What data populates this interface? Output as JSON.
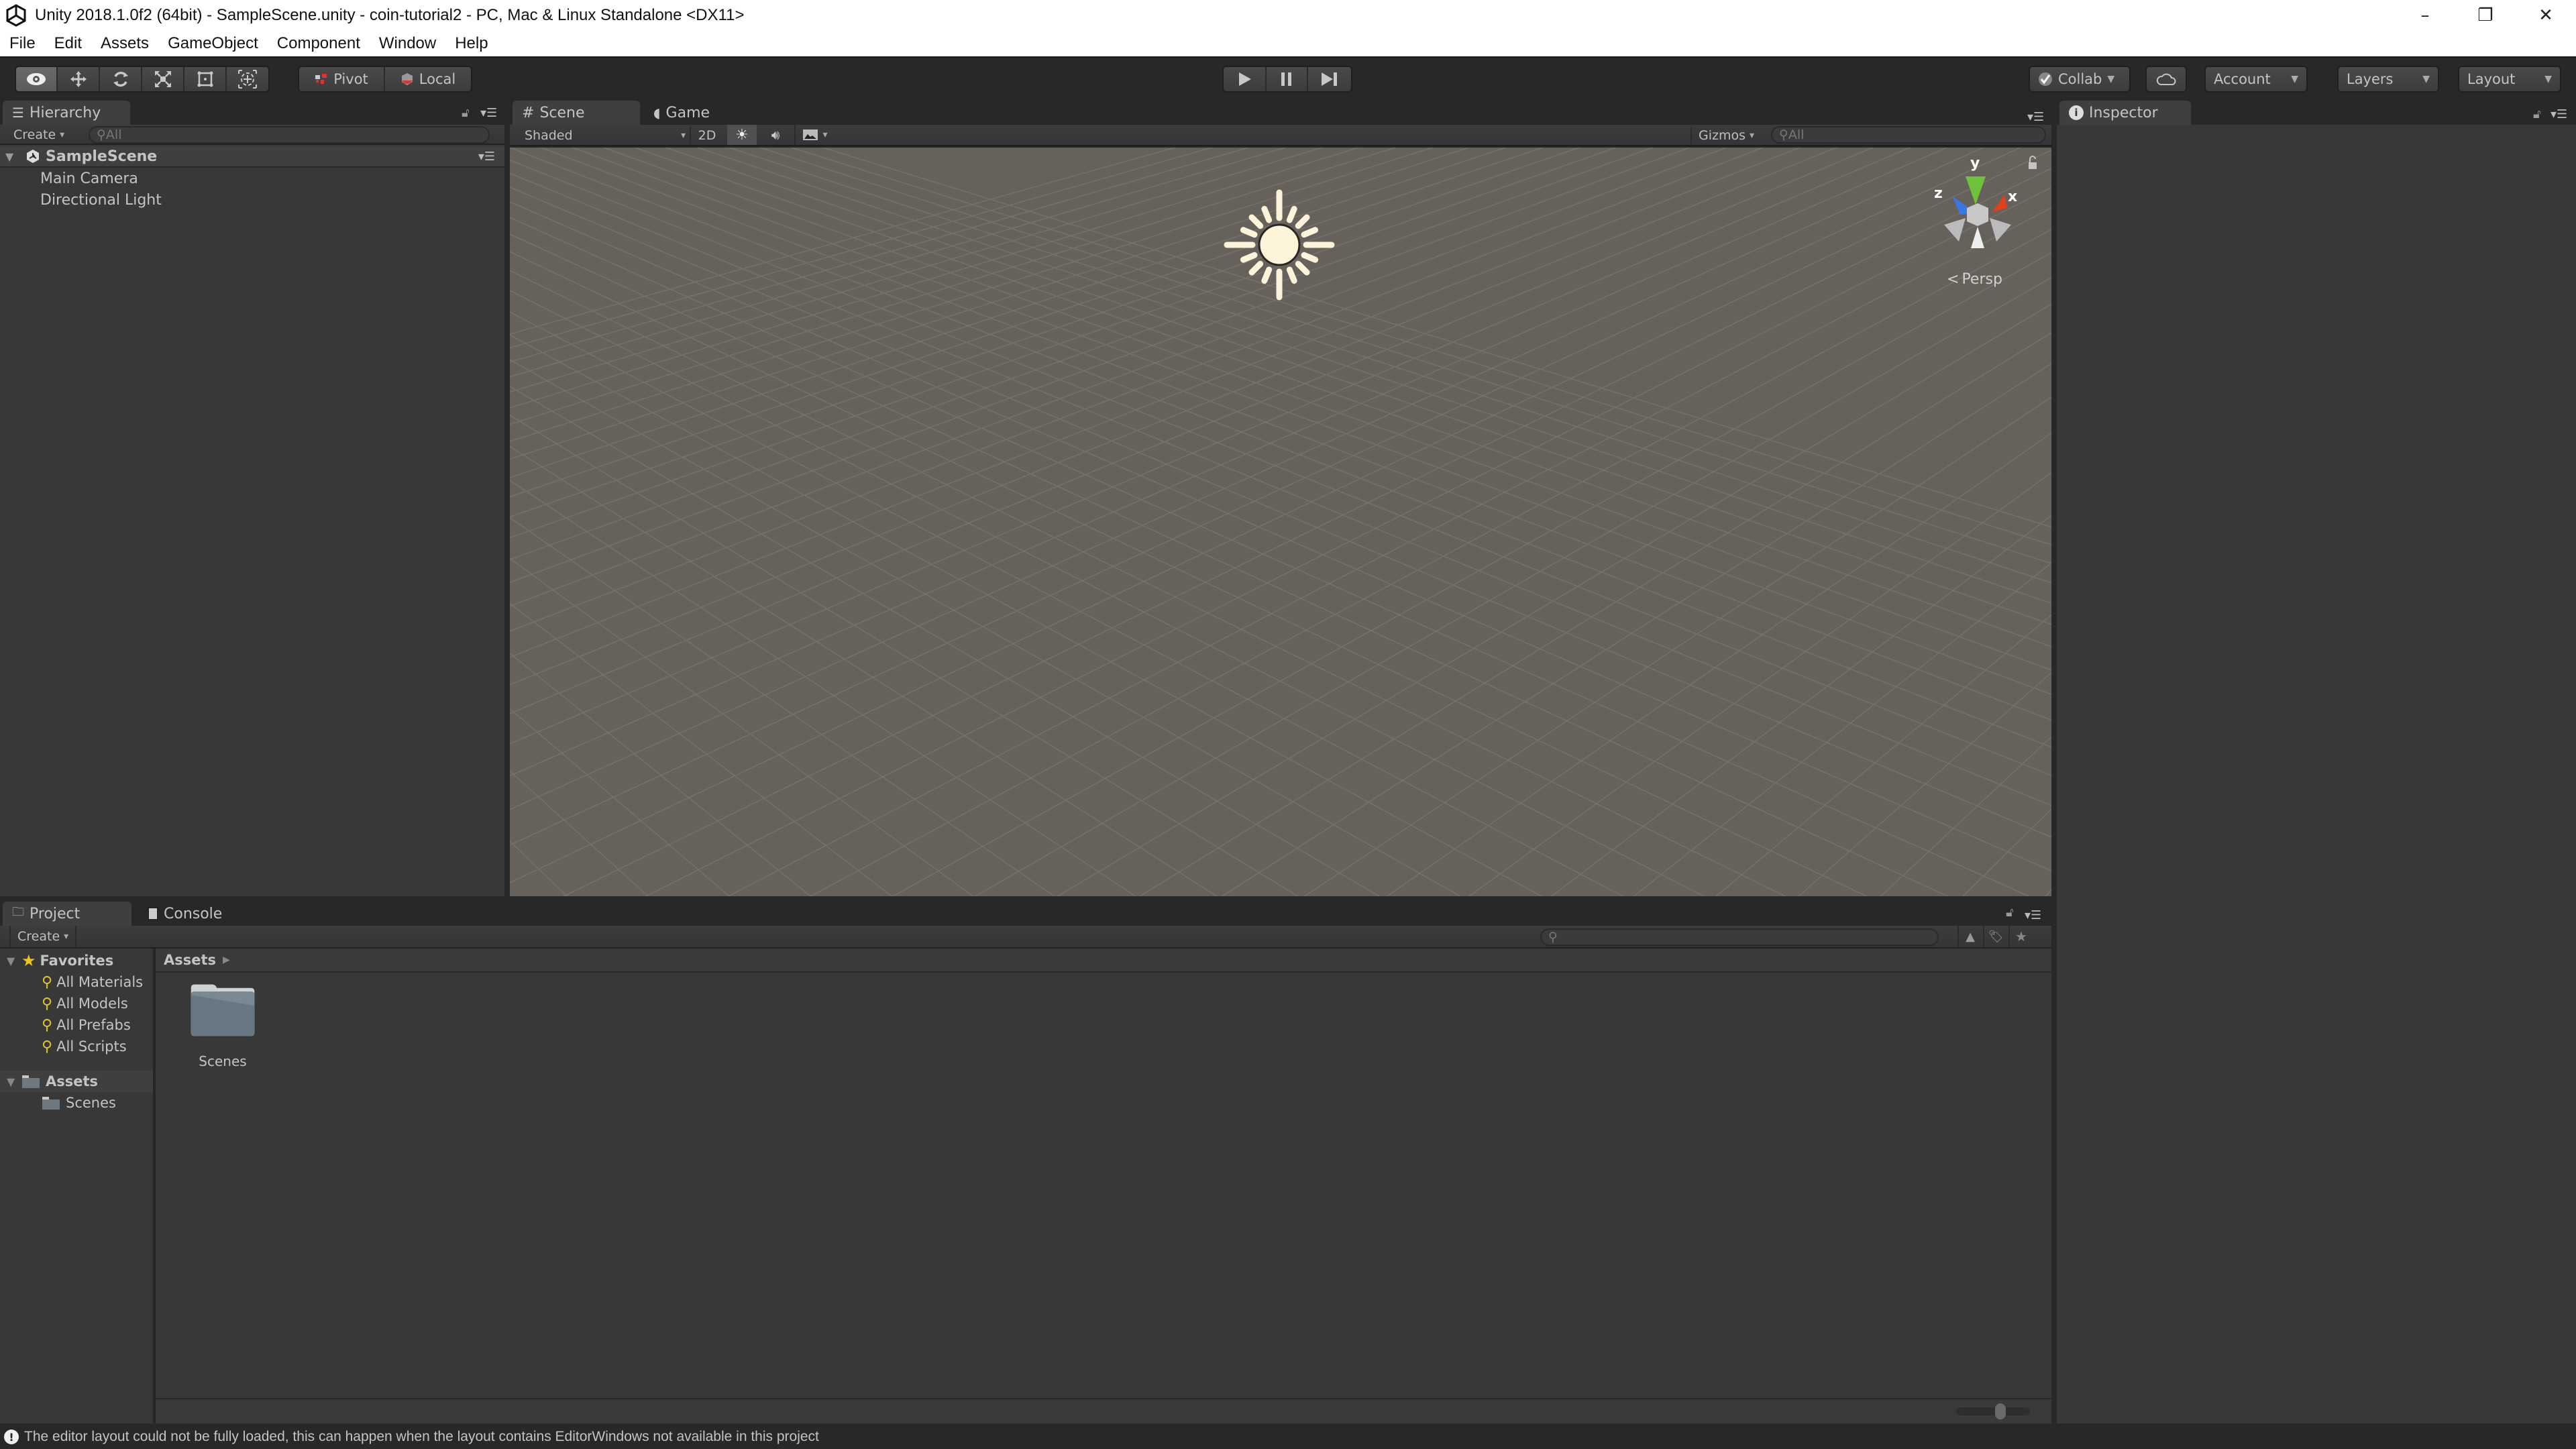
{
  "window": {
    "title": "Unity 2018.1.0f2 (64bit) - SampleScene.unity - coin-tutorial2 - PC, Mac & Linux Standalone <DX11>",
    "controls": {
      "minimize": "–",
      "restore": "❐",
      "close": "✕"
    }
  },
  "menubar": {
    "items": [
      "File",
      "Edit",
      "Assets",
      "GameObject",
      "Component",
      "Window",
      "Help"
    ]
  },
  "toolbar": {
    "tools": [
      {
        "name": "view-tool",
        "icon": "eye-icon",
        "active": true
      },
      {
        "name": "move-tool",
        "icon": "move-arrows-icon",
        "active": false
      },
      {
        "name": "rotate-tool",
        "icon": "rotate-icon",
        "active": false
      },
      {
        "name": "scale-tool",
        "icon": "scale-icon",
        "active": false
      },
      {
        "name": "rect-tool",
        "icon": "rect-icon",
        "active": false
      },
      {
        "name": "transform-tool",
        "icon": "transform-icon",
        "active": false
      }
    ],
    "pivot_label": "Pivot",
    "local_label": "Local",
    "play": "▶",
    "pause": "❚❚",
    "step": "▶❙",
    "collab_label": "Collab",
    "account_label": "Account",
    "layers_label": "Layers",
    "layout_label": "Layout"
  },
  "hierarchy": {
    "tab_label": "Hierarchy",
    "create_label": "Create",
    "search_placeholder": "All",
    "scene_name": "SampleScene",
    "items": [
      "Main Camera",
      "Directional Light"
    ]
  },
  "scene": {
    "tabs": [
      {
        "label": "Scene",
        "active": true
      },
      {
        "label": "Game",
        "active": false
      }
    ],
    "shading_mode": "Shaded",
    "mode_2d_label": "2D",
    "gizmos_label": "Gizmos",
    "search_placeholder": "All",
    "axes": {
      "x": "x",
      "y": "y",
      "z": "z"
    },
    "projection_label": "Persp",
    "colors": {
      "background": "#67615b",
      "grid": "#76716b",
      "x_axis": "#e0401c",
      "y_axis": "#6ec23a",
      "z_axis": "#3a78e0",
      "sun": "#fcf3d9"
    }
  },
  "inspector": {
    "tab_label": "Inspector"
  },
  "project": {
    "tabs": [
      {
        "label": "Project",
        "active": true
      },
      {
        "label": "Console",
        "active": false
      }
    ],
    "create_label": "Create",
    "favorites_label": "Favorites",
    "favorites": [
      "All Materials",
      "All Models",
      "All Prefabs",
      "All Scripts"
    ],
    "assets_root_label": "Assets",
    "asset_folders": [
      "Scenes"
    ],
    "breadcrumb": "Assets",
    "grid_items": [
      {
        "name": "Scenes",
        "type": "folder"
      }
    ],
    "search_placeholder": ""
  },
  "status": {
    "message": "The editor layout could not be fully loaded, this can happen when the layout contains EditorWindows not available in this project"
  }
}
